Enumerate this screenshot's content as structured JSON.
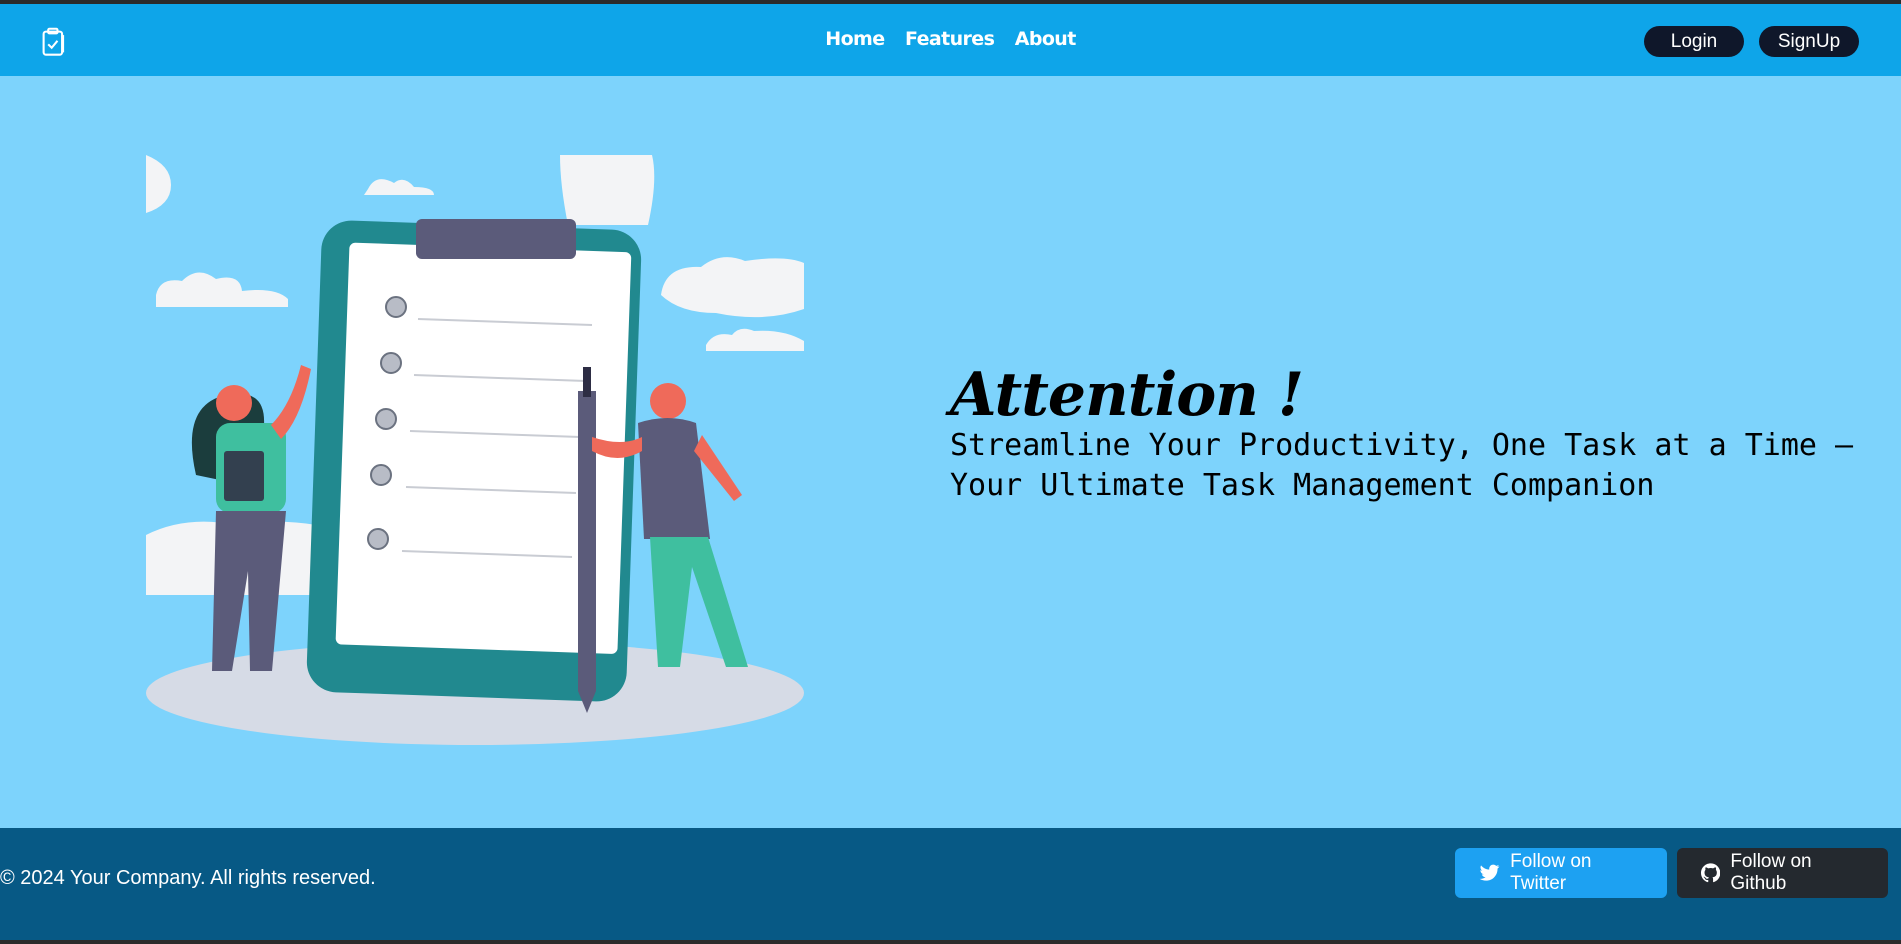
{
  "header": {
    "logo_icon": "clipboard-check-icon",
    "nav": [
      "Home",
      "Features",
      "About"
    ],
    "login_label": "Login",
    "signup_label": "SignUp"
  },
  "hero": {
    "headline": "Attention !",
    "tagline": "Streamline Your Productivity, One Task at a Time – Your Ultimate Task Management Companion",
    "illustration": "task-checklist-illustration"
  },
  "footer": {
    "copyright": "© 2024 Your Company. All rights reserved.",
    "twitter_label": "Follow on Twitter",
    "github_label": "Follow on Github",
    "twitter_icon": "twitter-icon",
    "github_icon": "github-icon"
  },
  "colors": {
    "header": "#0ea5e9",
    "hero_bg": "#7dd3fc",
    "footer": "#075985",
    "auth_button": "#0f172a",
    "twitter": "#1da1f2",
    "github": "#24292f"
  }
}
